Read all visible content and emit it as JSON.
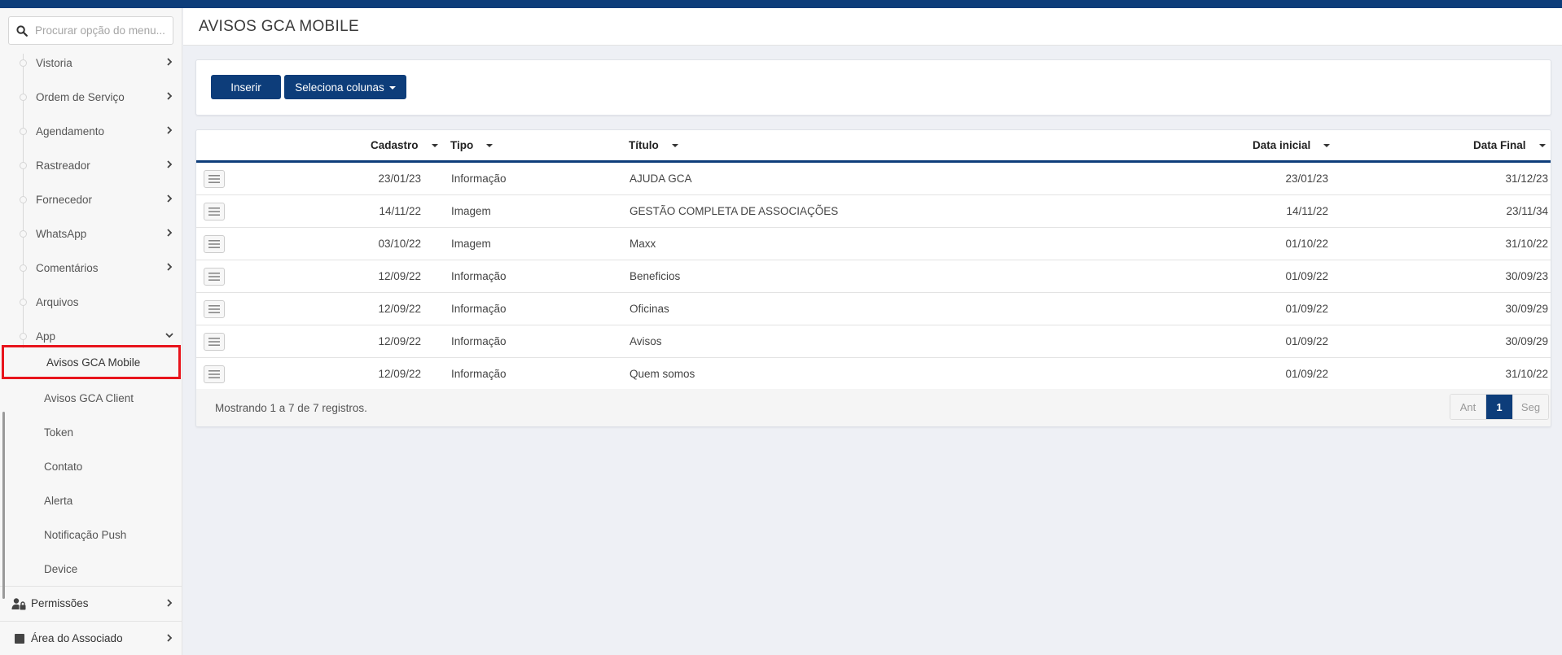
{
  "search": {
    "placeholder": "Procurar opção do menu..."
  },
  "sidebar": {
    "items": [
      {
        "label": "Vistoria",
        "has_children": true
      },
      {
        "label": "Ordem de Serviço",
        "has_children": true
      },
      {
        "label": "Agendamento",
        "has_children": true
      },
      {
        "label": "Rastreador",
        "has_children": true
      },
      {
        "label": "Fornecedor",
        "has_children": true
      },
      {
        "label": "WhatsApp",
        "has_children": true
      },
      {
        "label": "Comentários",
        "has_children": true
      },
      {
        "label": "Arquivos",
        "has_children": false
      },
      {
        "label": "App",
        "has_children": true,
        "expanded": true
      }
    ],
    "app_children": [
      {
        "label": "Avisos GCA Mobile",
        "active": true
      },
      {
        "label": "Avisos GCA Client"
      },
      {
        "label": "Token"
      },
      {
        "label": "Contato"
      },
      {
        "label": "Alerta"
      },
      {
        "label": "Notificação Push"
      },
      {
        "label": "Device"
      }
    ],
    "sections": [
      {
        "label": "Permissões",
        "icon": "user-lock-icon"
      },
      {
        "label": "Área do Associado",
        "icon": "square-icon"
      }
    ]
  },
  "header": {
    "title": "AVISOS GCA MOBILE"
  },
  "toolbar": {
    "insert_label": "Inserir",
    "columns_label": "Seleciona colunas"
  },
  "table": {
    "columns": [
      "Cadastro",
      "Tipo",
      "Título",
      "Data inicial",
      "Data Final"
    ],
    "rows": [
      [
        "23/01/23",
        "Informação",
        "AJUDA GCA",
        "23/01/23",
        "31/12/23"
      ],
      [
        "14/11/22",
        "Imagem",
        "GESTÃO COMPLETA DE ASSOCIAÇÕES",
        "14/11/22",
        "23/11/34"
      ],
      [
        "03/10/22",
        "Imagem",
        "Maxx",
        "01/10/22",
        "31/10/22"
      ],
      [
        "12/09/22",
        "Informação",
        "Beneficios",
        "01/09/22",
        "30/09/23"
      ],
      [
        "12/09/22",
        "Informação",
        "Oficinas",
        "01/09/22",
        "30/09/29"
      ],
      [
        "12/09/22",
        "Informação",
        "Avisos",
        "01/09/22",
        "30/09/29"
      ],
      [
        "12/09/22",
        "Informação",
        "Quem somos",
        "01/09/22",
        "31/10/22"
      ]
    ],
    "footer_info": "Mostrando 1 a 7 de 7 registros.",
    "pager": {
      "prev": "Ant",
      "current": "1",
      "next": "Seg"
    }
  },
  "colors": {
    "primary": "#0d3d7a",
    "highlight": "#e8141c"
  }
}
